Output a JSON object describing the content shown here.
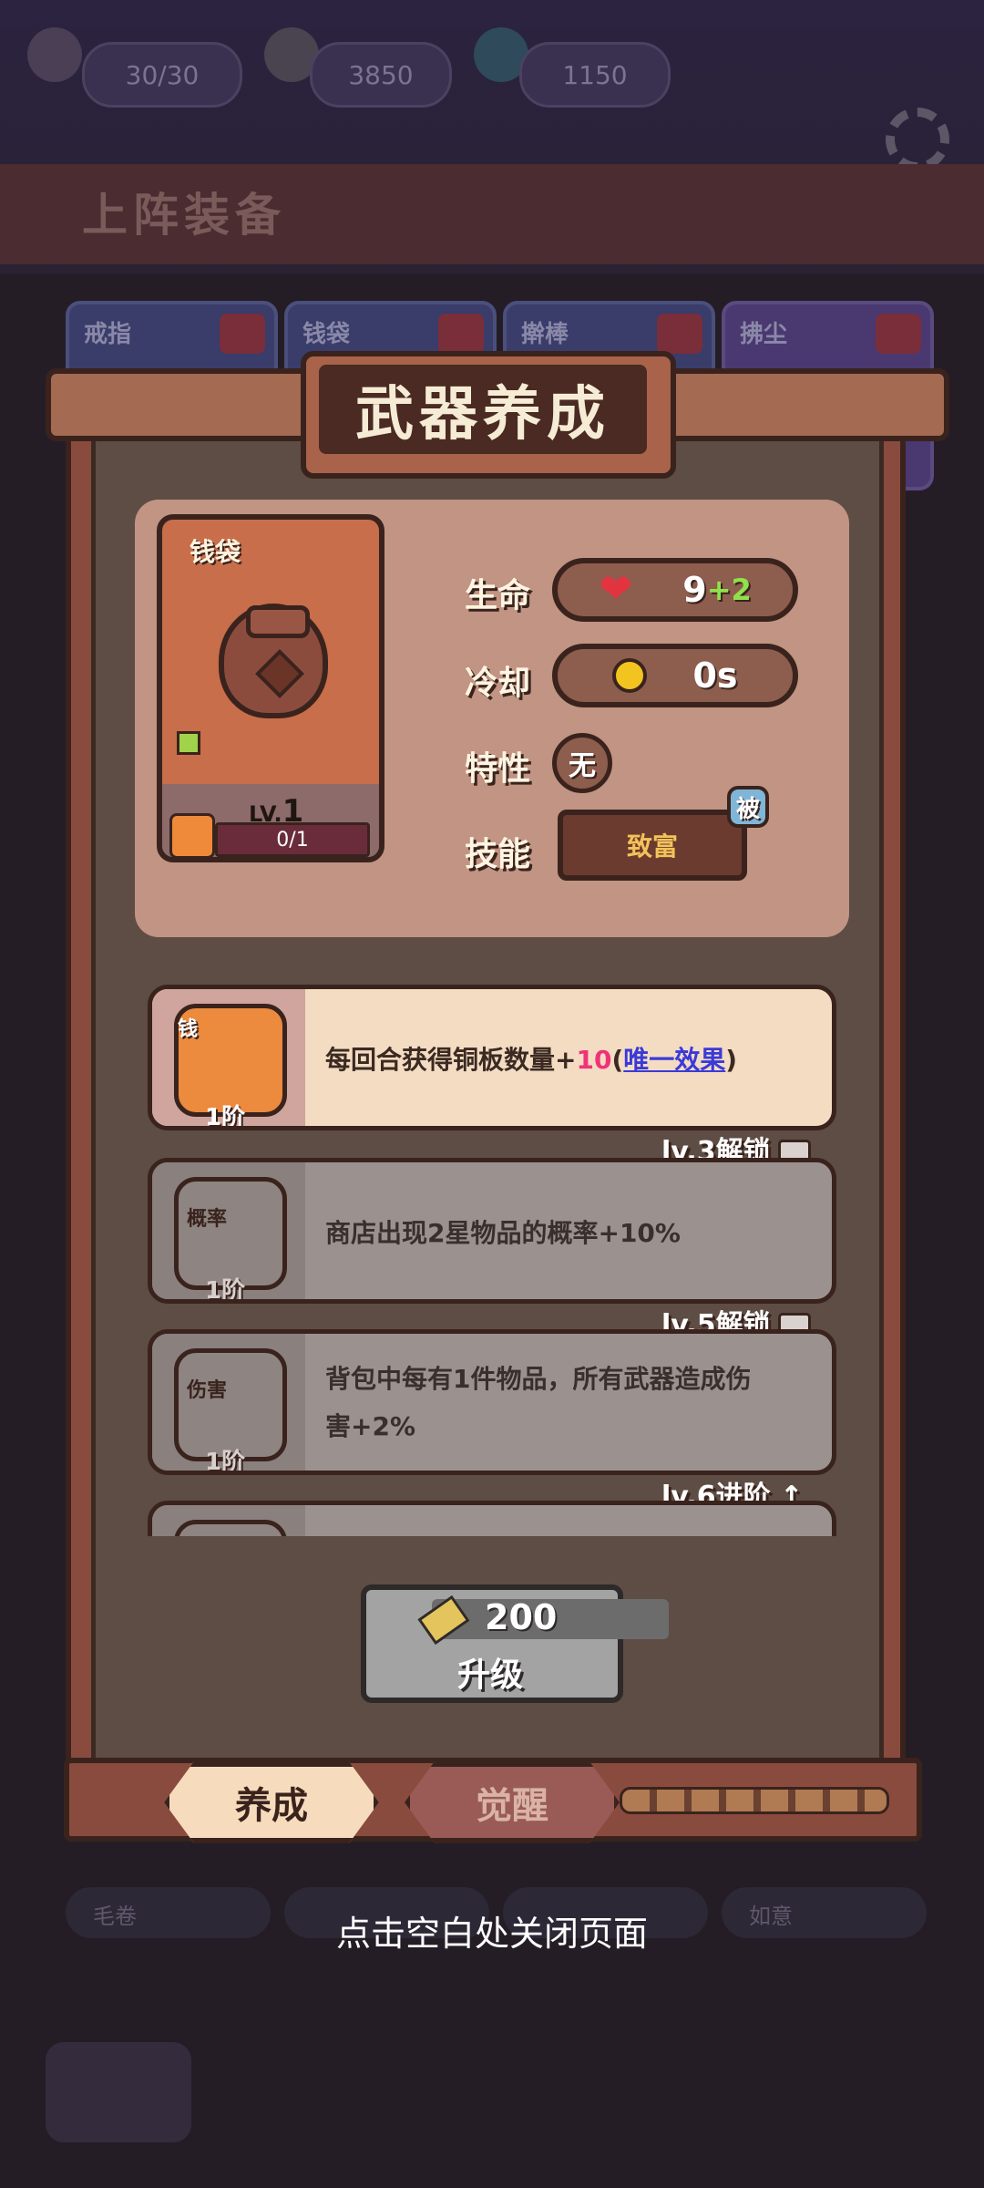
{
  "resources": [
    {
      "icon": "peach-icon",
      "value": "30/30"
    },
    {
      "icon": "key-icon",
      "value": "3850"
    },
    {
      "icon": "gem-ring-icon",
      "value": "1150"
    }
  ],
  "background": {
    "section_title": "上阵装备",
    "slots": [
      "戒指",
      "钱袋",
      "擀棒",
      "拂尘"
    ],
    "bottom_slots": [
      "毛卷",
      "",
      "",
      "如意"
    ]
  },
  "panel": {
    "title": "武器养成",
    "card": {
      "name": "钱袋",
      "level_prefix": "LV.",
      "level": "1",
      "progress": "0/1",
      "progress_fraction": 0
    },
    "stats": [
      {
        "label": "生命",
        "icon": "heart-icon",
        "value": "9",
        "bonus": "+2"
      },
      {
        "label": "冷却",
        "icon": "stopwatch-icon",
        "value": "0s",
        "bonus": ""
      }
    ],
    "trait": {
      "label": "特性",
      "value": "无"
    },
    "skill": {
      "label": "技能",
      "value": "致富",
      "badge": "被"
    },
    "upgrades": [
      {
        "tag": "钱",
        "tier": "1阶",
        "text_before": "每回合获得铜板数量+",
        "highlight": "10",
        "paren_open": "(",
        "link": "唯一效果",
        "paren_close": ")",
        "state": "unlocked"
      },
      {
        "unlock": "lv.3解锁",
        "tag": "概率",
        "tier": "1阶",
        "text": "商店出现2星物品的概率+10%",
        "state": "locked"
      },
      {
        "unlock": "lv.5解锁",
        "tag": "伤害",
        "tier": "1阶",
        "text_line1": "背包中每有1件物品，所有武器造成伤",
        "text_line2": "害+2%",
        "state": "locked"
      },
      {
        "unlock": "lv.6进阶 ↥",
        "state": "partial"
      }
    ],
    "upgrade_button": {
      "cost": "200",
      "label": "升级"
    },
    "tabs": [
      {
        "label": "养成",
        "active": true
      },
      {
        "label": "觉醒",
        "active": false
      }
    ],
    "close_hint": "点击空白处关闭页面"
  },
  "colors": {
    "accent_pink": "#f0327a",
    "link_blue": "#3a3ad8",
    "bonus_green": "#8fe24a",
    "skill_gold": "#f3c35a"
  }
}
